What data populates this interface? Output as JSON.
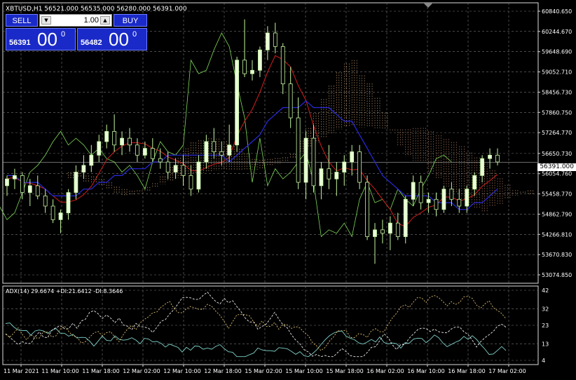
{
  "header": {
    "symbol_info": "XBTUSD,H1  56521.000 56535.000 56280.000 56391.000"
  },
  "trade_panel": {
    "sell_label": "SELL",
    "buy_label": "BUY",
    "lot_value": "1.00",
    "sell_price_base": "56391",
    "sell_price_big": "00",
    "sell_price_sup": "0",
    "buy_price_base": "56482",
    "buy_price_big": "00",
    "buy_price_sup": "0"
  },
  "price_axis": [
    "60840.650",
    "60244.670",
    "59648.690",
    "59052.710",
    "58456.730",
    "57860.750",
    "57264.770",
    "56650.730",
    "56054.760",
    "55458.770",
    "54862.790",
    "54266.810",
    "53670.830",
    "53074.850"
  ],
  "current_price_tag": "56391.000",
  "indicator": {
    "label": "ADX(14) 29.6674 +DI:21.6412 -DI:8.3646",
    "axis": [
      "42",
      "32",
      "23",
      "13",
      "4"
    ]
  },
  "time_axis": [
    "11 Mar 2021",
    "11 Mar 10:00",
    "11 Mar 18:00",
    "12 Mar 02:00",
    "12 Mar 10:00",
    "12 Mar 18:00",
    "15 Mar 02:00",
    "15 Mar 10:00",
    "15 Mar 18:00",
    "16 Mar 02:00",
    "16 Mar 10:00",
    "16 Mar 18:00",
    "17 Mar 02:00"
  ],
  "chart_data": {
    "type": "candlestick",
    "symbol": "XBTUSD",
    "timeframe": "H1",
    "ylim": [
      53074.85,
      60840.65
    ],
    "candles": [
      [
        55700,
        56000,
        55400,
        55900
      ],
      [
        55900,
        56200,
        55600,
        56000
      ],
      [
        56000,
        56100,
        55300,
        55500
      ],
      [
        55500,
        55900,
        55100,
        55700
      ],
      [
        55700,
        56000,
        55300,
        55400
      ],
      [
        55400,
        55600,
        54900,
        55100
      ],
      [
        55100,
        55300,
        54600,
        54700
      ],
      [
        54700,
        55000,
        54300,
        54900
      ],
      [
        54900,
        55600,
        54700,
        55500
      ],
      [
        55500,
        56300,
        55300,
        56100
      ],
      [
        56100,
        56600,
        55900,
        56300
      ],
      [
        56300,
        56900,
        56100,
        56600
      ],
      [
        56600,
        57200,
        56400,
        57000
      ],
      [
        57000,
        57500,
        56800,
        57300
      ],
      [
        57300,
        57800,
        56700,
        56900
      ],
      [
        56900,
        57300,
        56600,
        57100
      ],
      [
        57100,
        57400,
        56700,
        56900
      ],
      [
        56900,
        57100,
        56400,
        56600
      ],
      [
        56600,
        57000,
        56500,
        56800
      ],
      [
        56800,
        57100,
        56400,
        56500
      ],
      [
        56500,
        56800,
        56200,
        56400
      ],
      [
        56400,
        56700,
        55900,
        56100
      ],
      [
        56100,
        56500,
        55900,
        56300
      ],
      [
        56300,
        56600,
        55700,
        56000
      ],
      [
        56000,
        56300,
        55400,
        55600
      ],
      [
        55600,
        56600,
        55500,
        56400
      ],
      [
        56400,
        57200,
        56200,
        57000
      ],
      [
        57000,
        57400,
        56500,
        56700
      ],
      [
        56700,
        57000,
        56300,
        56600
      ],
      [
        56600,
        57500,
        56400,
        56900
      ],
      [
        56900,
        59500,
        56700,
        59400
      ],
      [
        59400,
        60600,
        58900,
        59000
      ],
      [
        59000,
        59400,
        58800,
        59100
      ],
      [
        59100,
        59800,
        58900,
        59700
      ],
      [
        59700,
        60400,
        59400,
        60200
      ],
      [
        60200,
        60500,
        59600,
        59800
      ],
      [
        59800,
        59900,
        58400,
        58700
      ],
      [
        58700,
        59200,
        57400,
        57700
      ],
      [
        57700,
        58300,
        55600,
        55800
      ],
      [
        55800,
        57300,
        55300,
        57100
      ],
      [
        57100,
        57500,
        55500,
        55700
      ],
      [
        55700,
        56400,
        55300,
        56200
      ],
      [
        56200,
        56900,
        55600,
        55900
      ],
      [
        55900,
        56400,
        55400,
        56100
      ],
      [
        56100,
        56600,
        55700,
        56400
      ],
      [
        56400,
        56900,
        56000,
        56700
      ],
      [
        56700,
        56900,
        55600,
        55800
      ],
      [
        55800,
        56000,
        54100,
        54200
      ],
      [
        54200,
        54600,
        53400,
        54400
      ],
      [
        54400,
        54700,
        54000,
        54300
      ],
      [
        54300,
        54800,
        53800,
        54600
      ],
      [
        54600,
        54900,
        54100,
        54200
      ],
      [
        54200,
        55400,
        54000,
        55300
      ],
      [
        55300,
        56000,
        55100,
        55800
      ],
      [
        55800,
        56000,
        55000,
        55200
      ],
      [
        55200,
        55500,
        54900,
        55300
      ],
      [
        55300,
        55500,
        54800,
        55000
      ],
      [
        55000,
        55700,
        54900,
        55600
      ],
      [
        55600,
        55800,
        55100,
        55300
      ],
      [
        55300,
        55600,
        54900,
        55100
      ],
      [
        55100,
        55700,
        54900,
        55600
      ],
      [
        55600,
        56100,
        55400,
        56000
      ],
      [
        56000,
        56600,
        55800,
        56500
      ],
      [
        56500,
        56800,
        56200,
        56600
      ],
      [
        56600,
        56800,
        56300,
        56400
      ]
    ],
    "indicator": {
      "name": "ADX(14)",
      "adx": 29.6674,
      "plus_di": 21.6412,
      "minus_di": 8.3646,
      "ylim": [
        4,
        42
      ]
    }
  }
}
